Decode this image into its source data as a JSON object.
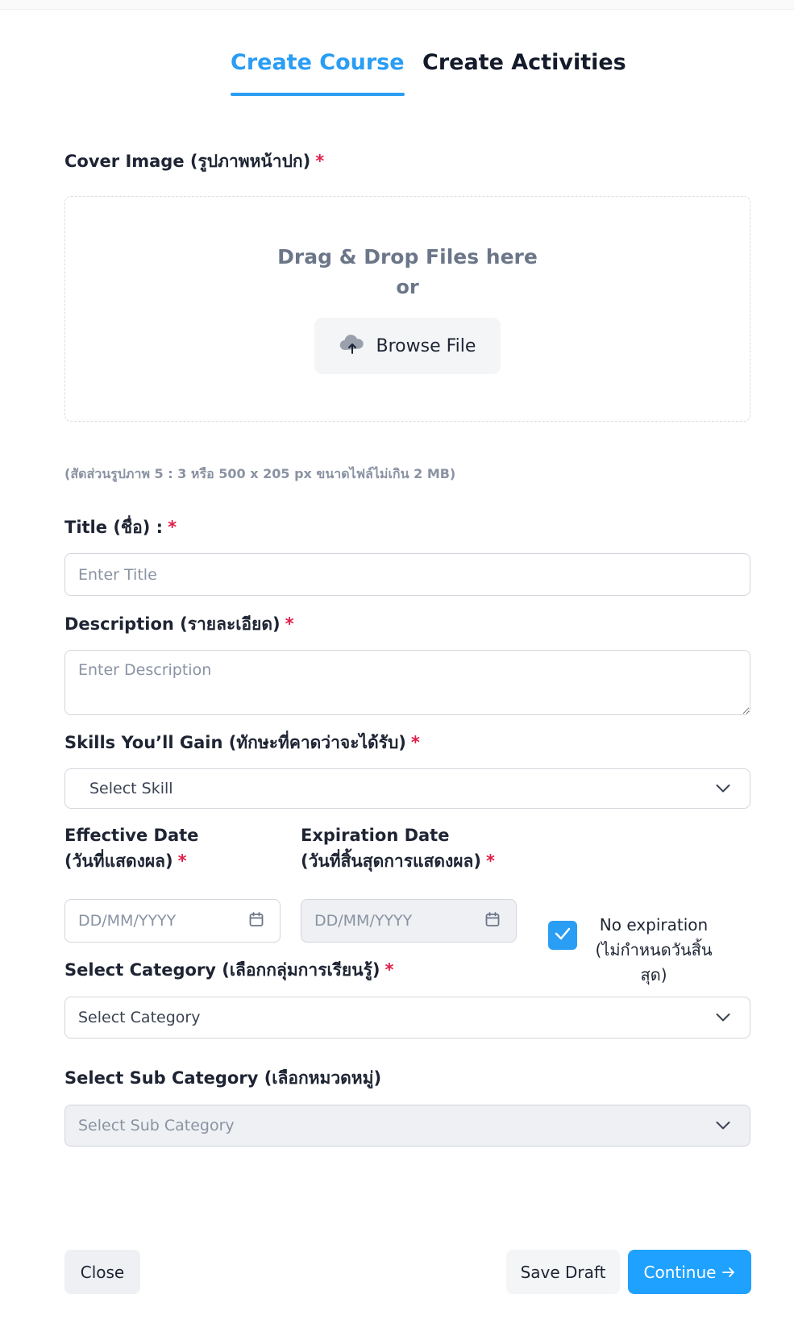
{
  "tabs": {
    "create_course": "Create Course",
    "create_activities": "Create Activities"
  },
  "cover": {
    "label": "Cover Image (รูปภาพหน้าปก)",
    "required": "*",
    "drag_text": "Drag & Drop Files here",
    "or_text": "or",
    "browse_label": "Browse File",
    "hint": "(สัดส่วนรูปภาพ 5 : 3 หรือ 500 x 205 px ขนาดไฟล์ไม่เกิน 2 MB)"
  },
  "title_field": {
    "label": "Title (ชื่อ) :",
    "required": "*",
    "placeholder": "Enter Title"
  },
  "description_field": {
    "label": "Description (รายละเอียด)",
    "required": "*",
    "placeholder": "Enter Description"
  },
  "skills_field": {
    "label": "Skills You’ll Gain (ทักษะที่คาดว่าจะได้รับ)",
    "required": "*",
    "selected": "Select Skill"
  },
  "effective_date": {
    "label_line1": "Effective Date",
    "label_line2": "(วันที่แสดงผล)",
    "required": "*",
    "placeholder": "DD/MM/YYYY"
  },
  "expiration_date": {
    "label_line1": "Expiration Date",
    "label_line2": "(วันที่สิ้นสุดการแสดงผล)",
    "required": "*",
    "placeholder": "DD/MM/YYYY"
  },
  "no_expiration": {
    "line1": "No expiration",
    "line2": "(ไม่กำหนดวันสิ้นสุด)",
    "checked": true
  },
  "category_field": {
    "label": "Select Category (เลือกกลุ่มการเรียนรู้)",
    "required": "*",
    "selected": "Select Category"
  },
  "subcategory_field": {
    "label": "Select Sub Category (เลือกหมวดหมู่)",
    "selected": "Select Sub Category"
  },
  "buttons": {
    "close": "Close",
    "save_draft": "Save Draft",
    "continue": "Continue"
  },
  "colors": {
    "accent": "#2a9df4",
    "required": "#e11d48",
    "primary_button": "#1ea1ff"
  }
}
